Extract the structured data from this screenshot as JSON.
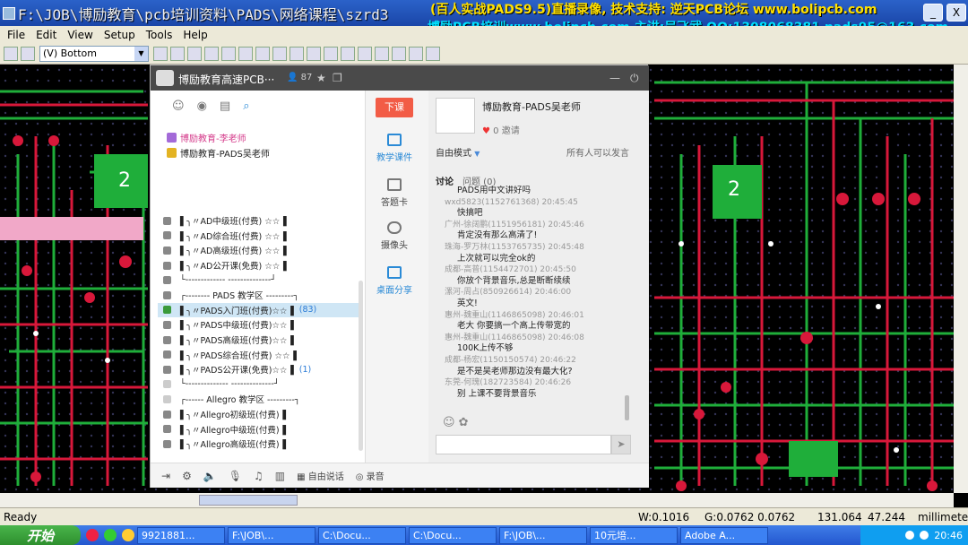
{
  "window": {
    "title": "F:\\JOB\\博励教育\\pcb培训资料\\PADS\\网络课程\\szrd3",
    "promo_line1": "(百人实战PADS9.5)直播录像, 技术支持: 逆天PCB论坛 www.bolipcb.com",
    "promo_line2": "博励PCB培训www.bolipcb.com 主讲:吴飞武 QQ:1308068381 pads95@163.com",
    "min_label": "_",
    "close_label": "X"
  },
  "menu": [
    "File",
    "Edit",
    "View",
    "Setup",
    "Tools",
    "Help"
  ],
  "toolbar": {
    "layer_value": "(V) Bottom",
    "dropdown_glyph": "▼"
  },
  "status": {
    "ready": "Ready",
    "w": "W:0.1016",
    "g": "G:0.0762 0.0762",
    "x": "131.064",
    "y": "47.244",
    "units": "millimeters"
  },
  "taskbar": {
    "start": "开始",
    "tasks": [
      "9921881...",
      "F:\\JOB\\...",
      "C:\\Docu...",
      "C:\\Docu...",
      "F:\\JOB\\...",
      "10元培...",
      "Adobe A..."
    ],
    "time": "20:46"
  },
  "chat": {
    "title": "博励教育高速PCB···",
    "count": "87",
    "leave_class": "下课",
    "members": [
      {
        "name": "博励教育-李老师",
        "color": "#d43a8a"
      },
      {
        "name": "博励教育-PADS吴老师",
        "color": "#222"
      }
    ],
    "channels": [
      {
        "label": "▌╮〃AD中级班(付费) ☆☆▐",
        "count": ""
      },
      {
        "label": "▌╮〃AD综合班(付费) ☆☆▐",
        "count": ""
      },
      {
        "label": "▌╮〃AD高级班(付费) ☆☆▐",
        "count": ""
      },
      {
        "label": "▌╮〃AD公开课(免费) ☆☆▐",
        "count": ""
      },
      {
        "label": "└------------- --------------┘",
        "count": ""
      },
      {
        "label": "┌-------- PADS 教学区 ---------┐",
        "count": ""
      },
      {
        "label": "▌╮〃PADS入门班(付费)☆☆▐",
        "count": "(83)"
      },
      {
        "label": "▌╮〃PADS中级班(付费)☆☆▐",
        "count": ""
      },
      {
        "label": "▌╮〃PADS高级班(付费)☆☆▐",
        "count": ""
      },
      {
        "label": "▌╮〃PADS综合班(付费) ☆☆▐",
        "count": ""
      },
      {
        "label": "▌╮〃PADS公开课(免费)☆☆▐",
        "count": "(1)"
      },
      {
        "label": "└-------------- --------------┘",
        "count": ""
      },
      {
        "label": "┌------ Allegro 教学区 ---------┐",
        "count": ""
      },
      {
        "label": "▌╮〃Allegro初级班(付费)▐",
        "count": ""
      },
      {
        "label": "▌╮〃Allegro中级班(付费)▐",
        "count": ""
      },
      {
        "label": "▌╮〃Allegro高级班(付费)▐",
        "count": ""
      }
    ],
    "tools": [
      "教学课件",
      "答题卡",
      "摄像头",
      "桌面分享"
    ],
    "bottom_label": "自由说话",
    "record_label": "录音",
    "teacher_name": "博励教育-PADS吴老师",
    "invite": "0 邀请",
    "mode": "自由模式",
    "mode_caret": "▼",
    "permission": "所有人可以发言",
    "tab_discuss": "讨论",
    "tab_question": "问题 (0)",
    "messages": [
      {
        "who": "",
        "text": "PADS用中文讲好吗"
      },
      {
        "who": "wxd5823(1152761368) 20:45:45",
        "text": "快搞吧"
      },
      {
        "who": "广州-徐阔鹏(1151956181) 20:45:46",
        "text": "肯定没有那么高清了!"
      },
      {
        "who": "珠海-罗万林(1153765735) 20:45:48",
        "text": "上次就可以完全ok的"
      },
      {
        "who": "成都-高普(1154472701) 20:45:50",
        "text": "你放个背景音乐,总是断断续续"
      },
      {
        "who": "漯河-周占(850926614) 20:46:00",
        "text": "英文!"
      },
      {
        "who": "惠州-魏重山(1146865098) 20:46:01",
        "text": "老大 你要搞一个高上传带宽的"
      },
      {
        "who": "惠州-魏重山(1146865098) 20:46:08",
        "text": "100K上传不够"
      },
      {
        "who": "成都-杨宏(1150150574) 20:46:22",
        "text": "是不是吴老师那边没有最大化?"
      },
      {
        "who": "东莞-何瑰(182723584) 20:46:26",
        "text": "别 上课不要背景音乐"
      }
    ]
  }
}
